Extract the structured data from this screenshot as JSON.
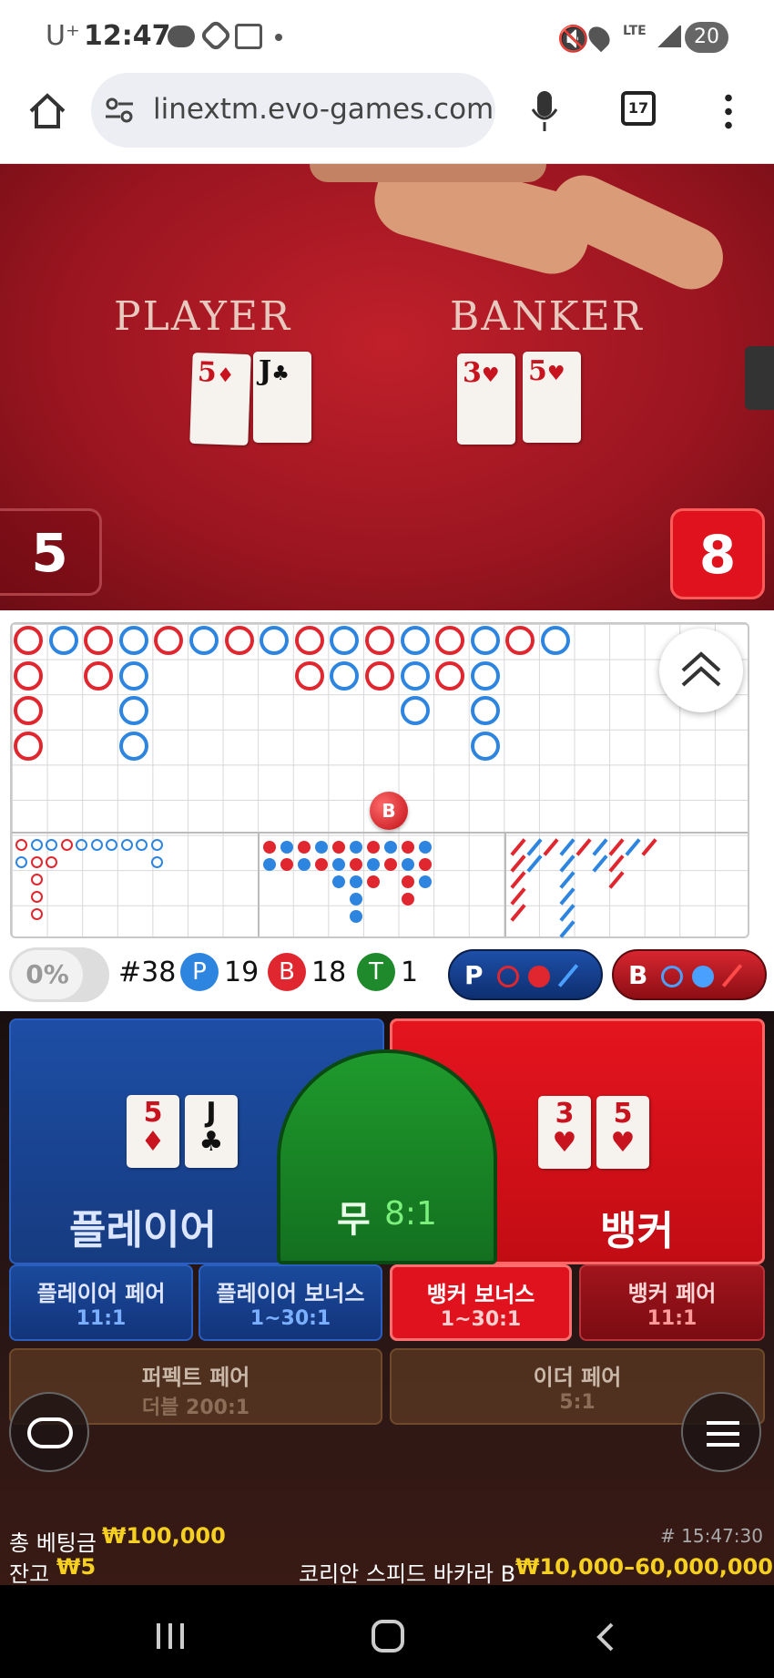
{
  "status_bar": {
    "carrier": "U⁺",
    "time": "12:47",
    "battery": "20",
    "network": "LTE"
  },
  "browser": {
    "url": "linextm.evo-games.com",
    "tab_count": "17"
  },
  "video": {
    "player_label": "PLAYER",
    "banker_label": "BANKER",
    "player_cards": [
      {
        "rank": "5",
        "suit": "♦",
        "color": "red"
      },
      {
        "rank": "J",
        "suit": "♣",
        "color": "black"
      }
    ],
    "banker_cards": [
      {
        "rank": "3",
        "suit": "♥",
        "color": "red"
      },
      {
        "rank": "5",
        "suit": "♥",
        "color": "red"
      }
    ],
    "player_score": "5",
    "banker_score": "8"
  },
  "road": {
    "bead_marker": "B"
  },
  "stats": {
    "percent": "0%",
    "round": "#38",
    "p_label": "P",
    "p_count": "19",
    "b_label": "B",
    "b_count": "18",
    "t_label": "T",
    "t_count": "1",
    "predict_p": "P",
    "predict_b": "B"
  },
  "bets": {
    "player": "플레이어",
    "tie": "무",
    "tie_odds": "8:1",
    "banker": "뱅커",
    "player_pair": "플레이어 페어",
    "player_pair_odds": "11:1",
    "player_bonus": "플레이어 보너스",
    "player_bonus_odds": "1~30:1",
    "banker_bonus": "뱅커 보너스",
    "banker_bonus_odds": "1~30:1",
    "banker_pair": "뱅커 페어",
    "banker_pair_odds": "11:1",
    "perfect_pair": "퍼펙트 페어",
    "perfect_pair_odds": "더블 200:1",
    "either_pair": "이더 페어",
    "either_pair_odds": "5:1"
  },
  "info": {
    "total_bet_label": "총 베팅금",
    "total_bet": "₩100,000",
    "balance_label": "잔고",
    "balance": "₩5",
    "game_id": "# 15:47:30",
    "table_name": "코리안 스피드 바카라 B",
    "limits": "₩10,000–60,000,000"
  },
  "colors": {
    "red": "#e0262e",
    "blue": "#2e85e0",
    "green": "#1f8a2c"
  }
}
